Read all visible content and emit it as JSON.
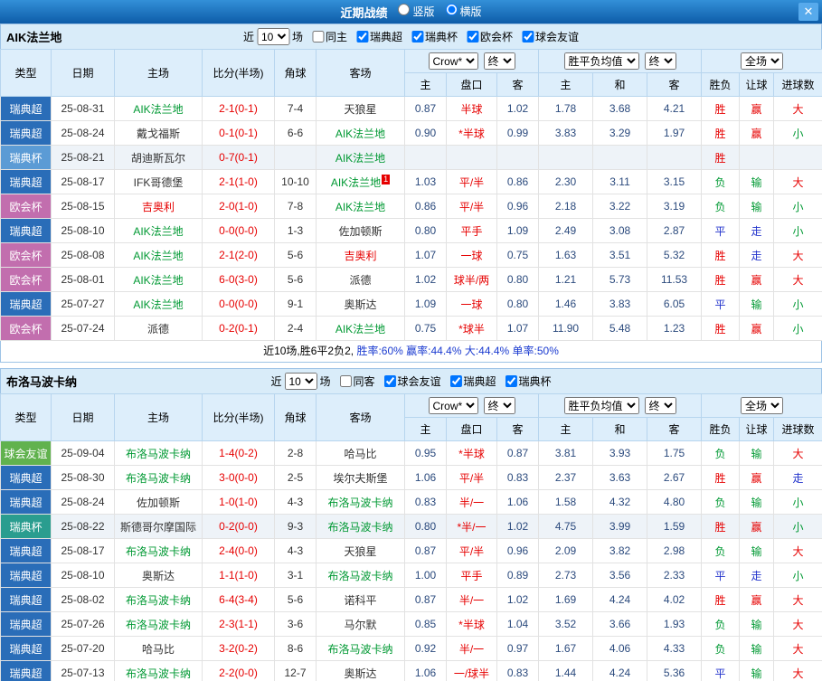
{
  "titlebar": {
    "title": "近期战绩",
    "radios": [
      {
        "label": "竖版",
        "checked": false
      },
      {
        "label": "横版",
        "checked": true
      }
    ],
    "close_label": "✕"
  },
  "filter_common": {
    "near": "近",
    "count": "10",
    "unit": "场"
  },
  "header": {
    "type": "类型",
    "date": "日期",
    "home": "主场",
    "score": "比分(半场)",
    "corner": "角球",
    "away": "客场",
    "odds_group": {
      "select1": "Crow*",
      "select2": "终",
      "home": "主",
      "handicap": "盘口",
      "away": "客"
    },
    "avg_group": {
      "select1": "胜平负均值",
      "select2": "终",
      "home": "主",
      "draw": "和",
      "away": "客"
    },
    "result_group": {
      "select1": "全场",
      "wl": "胜负",
      "handicap": "让球",
      "goals": "进球数"
    }
  },
  "colors": {
    "win_red": "#e60000",
    "lose_green": "#009933",
    "draw_blue": "#2233cc",
    "odds_navy": "#2b4a7d",
    "focus_team_green": "#009933",
    "rival_team_red": "#e60000"
  },
  "sections": [
    {
      "team": "AIK法兰地",
      "filter": {
        "same_label": "同主",
        "same_checked": false,
        "leagues": [
          {
            "label": "瑞典超",
            "checked": true
          },
          {
            "label": "瑞典杯",
            "checked": true
          },
          {
            "label": "欧会杯",
            "checked": true
          },
          {
            "label": "球会友谊",
            "checked": true
          }
        ]
      },
      "rows": [
        {
          "t": "瑞典超",
          "tc": "#2a6db8",
          "d": "25-08-31",
          "h": "AIK法兰地",
          "hc": "green",
          "s": "2-1(0-1)",
          "cn": "7-4",
          "a": "天狼星",
          "ac": "black",
          "o1": "0.87",
          "hd": "半球",
          "o2": "1.02",
          "m1": "1.78",
          "m2": "3.68",
          "m3": "4.21",
          "r1": "胜",
          "r1c": "red",
          "r2": "赢",
          "r2c": "red",
          "r3": "大",
          "r3c": "red",
          "hl": false
        },
        {
          "t": "瑞典超",
          "tc": "#2a6db8",
          "d": "25-08-24",
          "h": "戴戈福斯",
          "hc": "black",
          "s": "0-1(0-1)",
          "cn": "6-6",
          "a": "AIK法兰地",
          "ac": "green",
          "o1": "0.90",
          "hd": "*半球",
          "o2": "0.99",
          "m1": "3.83",
          "m2": "3.29",
          "m3": "1.97",
          "r1": "胜",
          "r1c": "red",
          "r2": "赢",
          "r2c": "red",
          "r3": "小",
          "r3c": "green",
          "hl": false
        },
        {
          "t": "瑞典杯",
          "tc": "#5b9bd5",
          "d": "25-08-21",
          "h": "胡迪斯瓦尔",
          "hc": "black",
          "s": "0-7(0-1)",
          "cn": "",
          "a": "AIK法兰地",
          "ac": "green",
          "o1": "",
          "hd": "",
          "o2": "",
          "m1": "",
          "m2": "",
          "m3": "",
          "r1": "胜",
          "r1c": "red",
          "r2": "",
          "r2c": "",
          "r3": "",
          "r3c": "",
          "hl": true
        },
        {
          "t": "瑞典超",
          "tc": "#2a6db8",
          "d": "25-08-17",
          "h": "IFK哥德堡",
          "hc": "black",
          "s": "2-1(1-0)",
          "cn": "10-10",
          "a": "AIK法兰地",
          "ac": "green",
          "asup": "1",
          "o1": "1.03",
          "hd": "平/半",
          "o2": "0.86",
          "m1": "2.30",
          "m2": "3.11",
          "m3": "3.15",
          "r1": "负",
          "r1c": "green",
          "r2": "输",
          "r2c": "green",
          "r3": "大",
          "r3c": "red",
          "hl": false
        },
        {
          "t": "欧会杯",
          "tc": "#c26eae",
          "d": "25-08-15",
          "h": "吉奥利",
          "hc": "red",
          "s": "2-0(1-0)",
          "cn": "7-8",
          "a": "AIK法兰地",
          "ac": "green",
          "o1": "0.86",
          "hd": "平/半",
          "o2": "0.96",
          "m1": "2.18",
          "m2": "3.22",
          "m3": "3.19",
          "r1": "负",
          "r1c": "green",
          "r2": "输",
          "r2c": "green",
          "r3": "小",
          "r3c": "green",
          "hl": false
        },
        {
          "t": "瑞典超",
          "tc": "#2a6db8",
          "d": "25-08-10",
          "h": "AIK法兰地",
          "hc": "green",
          "s": "0-0(0-0)",
          "cn": "1-3",
          "a": "佐加顿斯",
          "ac": "black",
          "o1": "0.80",
          "hd": "平手",
          "o2": "1.09",
          "m1": "2.49",
          "m2": "3.08",
          "m3": "2.87",
          "r1": "平",
          "r1c": "blue",
          "r2": "走",
          "r2c": "blue",
          "r3": "小",
          "r3c": "green",
          "hl": false
        },
        {
          "t": "欧会杯",
          "tc": "#c26eae",
          "d": "25-08-08",
          "h": "AIK法兰地",
          "hc": "green",
          "s": "2-1(2-0)",
          "cn": "5-6",
          "a": "吉奥利",
          "ac": "red",
          "o1": "1.07",
          "hd": "一球",
          "o2": "0.75",
          "m1": "1.63",
          "m2": "3.51",
          "m3": "5.32",
          "r1": "胜",
          "r1c": "red",
          "r2": "走",
          "r2c": "blue",
          "r3": "大",
          "r3c": "red",
          "hl": false
        },
        {
          "t": "欧会杯",
          "tc": "#c26eae",
          "d": "25-08-01",
          "h": "AIK法兰地",
          "hc": "green",
          "s": "6-0(3-0)",
          "cn": "5-6",
          "a": "派德",
          "ac": "black",
          "o1": "1.02",
          "hd": "球半/两",
          "o2": "0.80",
          "m1": "1.21",
          "m2": "5.73",
          "m3": "11.53",
          "r1": "胜",
          "r1c": "red",
          "r2": "赢",
          "r2c": "red",
          "r3": "大",
          "r3c": "red",
          "hl": false
        },
        {
          "t": "瑞典超",
          "tc": "#2a6db8",
          "d": "25-07-27",
          "h": "AIK法兰地",
          "hc": "green",
          "s": "0-0(0-0)",
          "cn": "9-1",
          "a": "奥斯达",
          "ac": "black",
          "o1": "1.09",
          "hd": "一球",
          "o2": "0.80",
          "m1": "1.46",
          "m2": "3.83",
          "m3": "6.05",
          "r1": "平",
          "r1c": "blue",
          "r2": "输",
          "r2c": "green",
          "r3": "小",
          "r3c": "green",
          "hl": false
        },
        {
          "t": "欧会杯",
          "tc": "#c26eae",
          "d": "25-07-24",
          "h": "派德",
          "hc": "black",
          "s": "0-2(0-1)",
          "cn": "2-4",
          "a": "AIK法兰地",
          "ac": "green",
          "o1": "0.75",
          "hd": "*球半",
          "o2": "1.07",
          "m1": "11.90",
          "m2": "5.48",
          "m3": "1.23",
          "r1": "胜",
          "r1c": "red",
          "r2": "赢",
          "r2c": "red",
          "r3": "小",
          "r3c": "green",
          "hl": false
        }
      ],
      "summary": {
        "parts": [
          {
            "text": "近10场,胜6平2负2, ",
            "blue": false
          },
          {
            "text": "胜率:60% ",
            "blue": true
          },
          {
            "text": "赢率:44.4% ",
            "blue": true
          },
          {
            "text": "大:44.4% ",
            "blue": true
          },
          {
            "text": "单率:50%",
            "blue": true
          }
        ]
      }
    },
    {
      "team": "布洛马波卡纳",
      "filter": {
        "same_label": "同客",
        "same_checked": false,
        "leagues": [
          {
            "label": "球会友谊",
            "checked": true
          },
          {
            "label": "瑞典超",
            "checked": true
          },
          {
            "label": "瑞典杯",
            "checked": true
          }
        ]
      },
      "rows": [
        {
          "t": "球会友谊",
          "tc": "#61b24e",
          "d": "25-09-04",
          "h": "布洛马波卡纳",
          "hc": "green",
          "s": "1-4(0-2)",
          "cn": "2-8",
          "a": "哈马比",
          "ac": "black",
          "o1": "0.95",
          "hd": "*半球",
          "o2": "0.87",
          "m1": "3.81",
          "m2": "3.93",
          "m3": "1.75",
          "r1": "负",
          "r1c": "green",
          "r2": "输",
          "r2c": "green",
          "r3": "大",
          "r3c": "red",
          "hl": false
        },
        {
          "t": "瑞典超",
          "tc": "#2a6db8",
          "d": "25-08-30",
          "h": "布洛马波卡纳",
          "hc": "green",
          "s": "3-0(0-0)",
          "cn": "2-5",
          "a": "埃尔夫斯堡",
          "ac": "black",
          "o1": "1.06",
          "hd": "平/半",
          "o2": "0.83",
          "m1": "2.37",
          "m2": "3.63",
          "m3": "2.67",
          "r1": "胜",
          "r1c": "red",
          "r2": "赢",
          "r2c": "red",
          "r3": "走",
          "r3c": "blue",
          "hl": false
        },
        {
          "t": "瑞典超",
          "tc": "#2a6db8",
          "d": "25-08-24",
          "h": "佐加顿斯",
          "hc": "black",
          "s": "1-0(1-0)",
          "cn": "4-3",
          "a": "布洛马波卡纳",
          "ac": "green",
          "o1": "0.83",
          "hd": "半/一",
          "o2": "1.06",
          "m1": "1.58",
          "m2": "4.32",
          "m3": "4.80",
          "r1": "负",
          "r1c": "green",
          "r2": "输",
          "r2c": "green",
          "r3": "小",
          "r3c": "green",
          "hl": false
        },
        {
          "t": "瑞典杯",
          "tc": "#2a9d8f",
          "d": "25-08-22",
          "h": "斯德哥尔摩国际",
          "hc": "black",
          "s": "0-2(0-0)",
          "cn": "9-3",
          "a": "布洛马波卡纳",
          "ac": "green",
          "o1": "0.80",
          "hd": "*半/一",
          "o2": "1.02",
          "m1": "4.75",
          "m2": "3.99",
          "m3": "1.59",
          "r1": "胜",
          "r1c": "red",
          "r2": "赢",
          "r2c": "red",
          "r3": "小",
          "r3c": "green",
          "hl": true
        },
        {
          "t": "瑞典超",
          "tc": "#2a6db8",
          "d": "25-08-17",
          "h": "布洛马波卡纳",
          "hc": "green",
          "s": "2-4(0-0)",
          "cn": "4-3",
          "a": "天狼星",
          "ac": "black",
          "o1": "0.87",
          "hd": "平/半",
          "o2": "0.96",
          "m1": "2.09",
          "m2": "3.82",
          "m3": "2.98",
          "r1": "负",
          "r1c": "green",
          "r2": "输",
          "r2c": "green",
          "r3": "大",
          "r3c": "red",
          "hl": false
        },
        {
          "t": "瑞典超",
          "tc": "#2a6db8",
          "d": "25-08-10",
          "h": "奥斯达",
          "hc": "black",
          "s": "1-1(1-0)",
          "cn": "3-1",
          "a": "布洛马波卡纳",
          "ac": "green",
          "o1": "1.00",
          "hd": "平手",
          "o2": "0.89",
          "m1": "2.73",
          "m2": "3.56",
          "m3": "2.33",
          "r1": "平",
          "r1c": "blue",
          "r2": "走",
          "r2c": "blue",
          "r3": "小",
          "r3c": "green",
          "hl": false
        },
        {
          "t": "瑞典超",
          "tc": "#2a6db8",
          "d": "25-08-02",
          "h": "布洛马波卡纳",
          "hc": "green",
          "s": "6-4(3-4)",
          "cn": "5-6",
          "a": "诺科平",
          "ac": "black",
          "o1": "0.87",
          "hd": "半/一",
          "o2": "1.02",
          "m1": "1.69",
          "m2": "4.24",
          "m3": "4.02",
          "r1": "胜",
          "r1c": "red",
          "r2": "赢",
          "r2c": "red",
          "r3": "大",
          "r3c": "red",
          "hl": false
        },
        {
          "t": "瑞典超",
          "tc": "#2a6db8",
          "d": "25-07-26",
          "h": "布洛马波卡纳",
          "hc": "green",
          "s": "2-3(1-1)",
          "cn": "3-6",
          "a": "马尔默",
          "ac": "black",
          "o1": "0.85",
          "hd": "*半球",
          "o2": "1.04",
          "m1": "3.52",
          "m2": "3.66",
          "m3": "1.93",
          "r1": "负",
          "r1c": "green",
          "r2": "输",
          "r2c": "green",
          "r3": "大",
          "r3c": "red",
          "hl": false
        },
        {
          "t": "瑞典超",
          "tc": "#2a6db8",
          "d": "25-07-20",
          "h": "哈马比",
          "hc": "black",
          "s": "3-2(0-2)",
          "cn": "8-6",
          "a": "布洛马波卡纳",
          "ac": "green",
          "o1": "0.92",
          "hd": "半/一",
          "o2": "0.97",
          "m1": "1.67",
          "m2": "4.06",
          "m3": "4.33",
          "r1": "负",
          "r1c": "green",
          "r2": "输",
          "r2c": "green",
          "r3": "大",
          "r3c": "red",
          "hl": false
        },
        {
          "t": "瑞典超",
          "tc": "#2a6db8",
          "d": "25-07-13",
          "h": "布洛马波卡纳",
          "hc": "green",
          "s": "2-2(0-0)",
          "cn": "12-7",
          "a": "奥斯达",
          "ac": "black",
          "o1": "1.06",
          "hd": "一/球半",
          "o2": "0.83",
          "m1": "1.44",
          "m2": "4.24",
          "m3": "5.36",
          "r1": "平",
          "r1c": "blue",
          "r2": "输",
          "r2c": "green",
          "r3": "大",
          "r3c": "red",
          "hl": false
        }
      ],
      "summary": null
    }
  ]
}
